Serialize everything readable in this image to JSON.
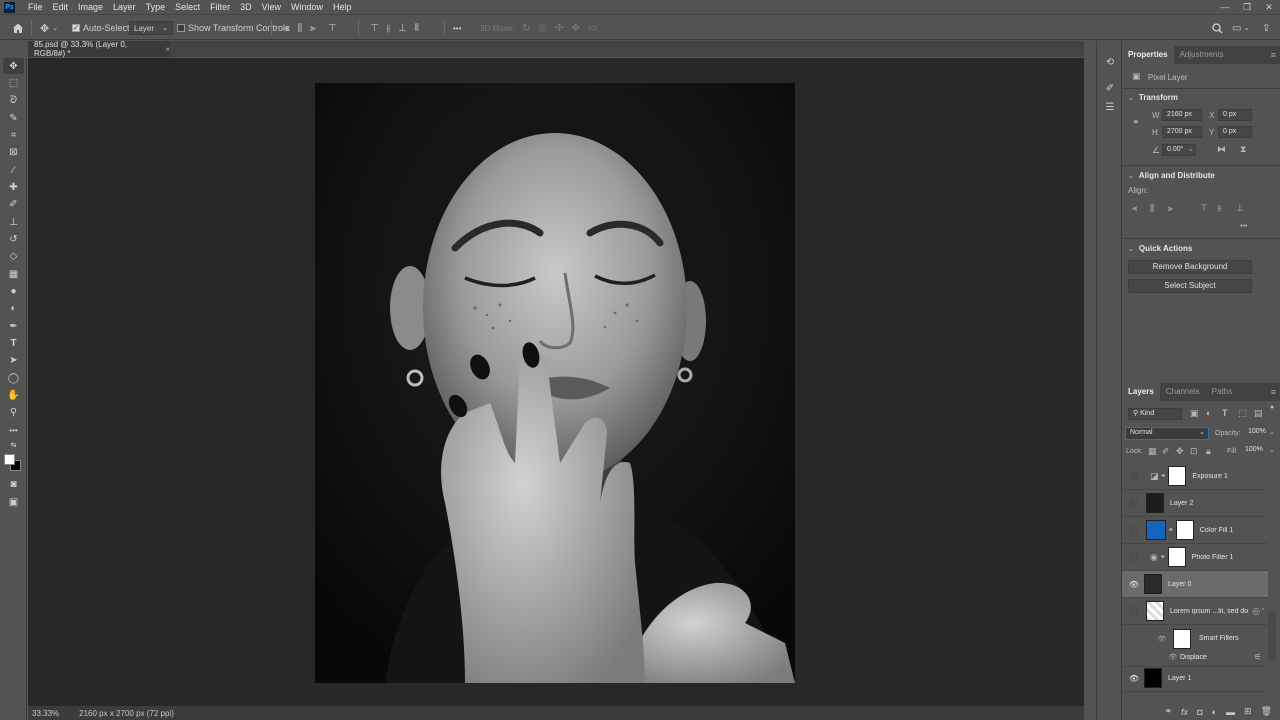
{
  "app": {
    "logo": "Ps"
  },
  "menu": [
    "File",
    "Edit",
    "Image",
    "Layer",
    "Type",
    "Select",
    "Filter",
    "3D",
    "View",
    "Window",
    "Help"
  ],
  "window_controls": {
    "minimize": "—",
    "restore": "❐",
    "close": "✕"
  },
  "options": {
    "auto_select_label": "Auto-Select:",
    "auto_select_target": "Layer",
    "transform_controls_label": "Show Transform Controls",
    "more": "•••",
    "mode_3d_label": "3D Mode:"
  },
  "document": {
    "tab_title": "85.psd @ 33.3% (Layer 0, RGB/8#) *",
    "tab_close": "×",
    "zoom": "33.33%",
    "dimensions": "2160 px x 2700 px (72 ppi)"
  },
  "properties": {
    "tabs": [
      "Properties",
      "Adjustments"
    ],
    "layer_kind": "Pixel Layer",
    "transform_title": "Transform",
    "w_label": "W",
    "w_value": "2160 px",
    "h_label": "H",
    "h_value": "2700 px",
    "x_label": "X",
    "x_value": "0 px",
    "y_label": "Y",
    "y_value": "0 px",
    "angle_value": "0.00°",
    "align_title": "Align and Distribute",
    "align_label": "Align:",
    "align_more": "•••",
    "quick_actions_title": "Quick Actions",
    "remove_background": "Remove Background",
    "select_subject": "Select Subject"
  },
  "layers_panel": {
    "tabs": [
      "Layers",
      "Channels",
      "Paths"
    ],
    "filter_kind": "Kind",
    "blend_mode": "Normal",
    "opacity_label": "Opacity:",
    "opacity_value": "100%",
    "lock_label": "Lock:",
    "fill_label": "Fill:",
    "fill_value": "100%",
    "layers": [
      {
        "name": "Exposure 1",
        "visible": false
      },
      {
        "name": "Layer 2",
        "visible": false
      },
      {
        "name": "Color Fill 1",
        "visible": false
      },
      {
        "name": "Photo Filter 1",
        "visible": false
      },
      {
        "name": "Layer 0",
        "visible": true
      },
      {
        "name": "Lorem ipsum ...lit, sed do",
        "visible": false
      },
      {
        "name": "Smart Filters",
        "visible": false
      },
      {
        "name": "Displace",
        "visible": false
      },
      {
        "name": "Layer 1",
        "visible": true
      }
    ]
  },
  "colors": {
    "color_fill_thumb": "#1565c0",
    "accent": "#31a8ff"
  }
}
